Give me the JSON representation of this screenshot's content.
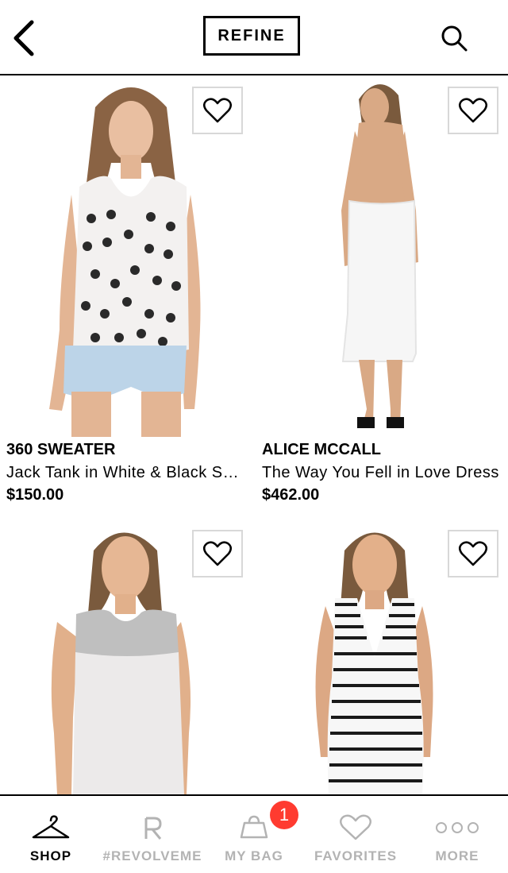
{
  "header": {
    "refine_label": "REFINE"
  },
  "products": [
    {
      "brand": "360 SWEATER",
      "name": "Jack Tank in White & Black Skull",
      "price": "$150.00"
    },
    {
      "brand": "ALICE MCCALL",
      "name": "The Way You Fell in Love Dress",
      "price": "$462.00"
    },
    {
      "brand": "",
      "name": "",
      "price": ""
    },
    {
      "brand": "",
      "name": "",
      "price": ""
    }
  ],
  "tabbar": {
    "shop": "SHOP",
    "revolveme": "#REVOLVEME",
    "mybag": "MY BAG",
    "favorites": "FAVORITES",
    "more": "MORE",
    "bag_count": "1"
  },
  "colors": {
    "badge": "#ff3b30",
    "inactive_tab": "#b3b3b3"
  }
}
